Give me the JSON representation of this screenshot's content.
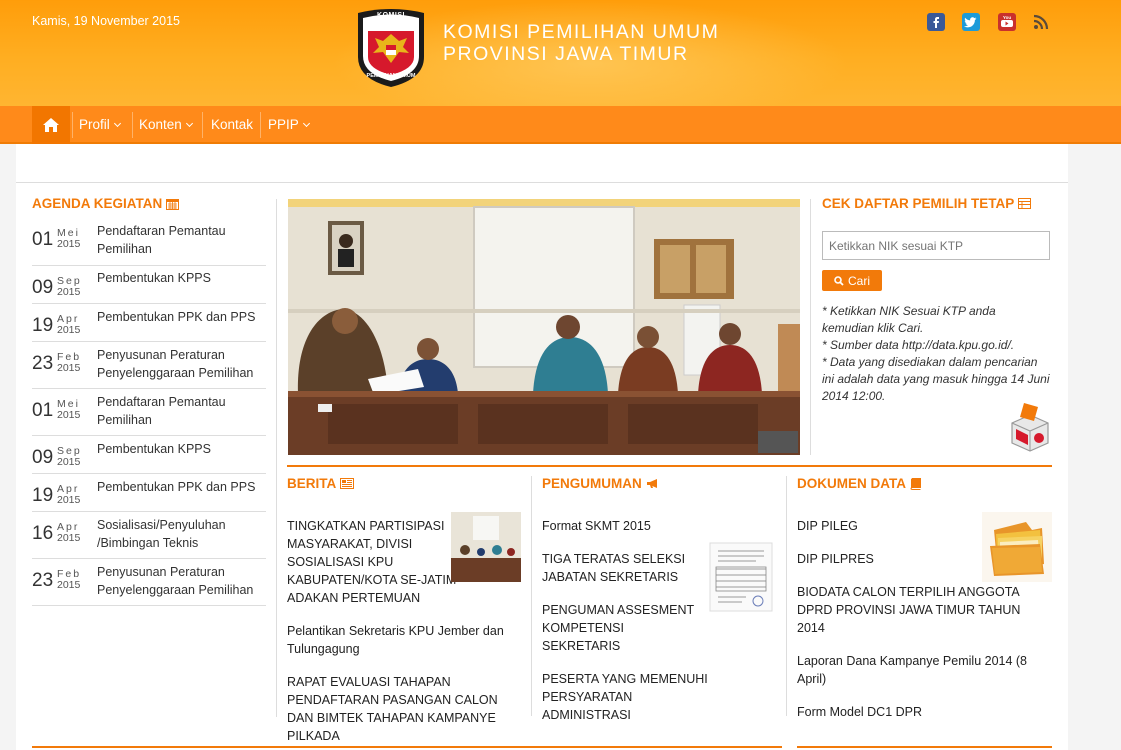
{
  "header": {
    "date": "Kamis, 19 November 2015",
    "title_line1": "KOMISI PEMILIHAN UMUM",
    "title_line2": "PROVINSI JAWA TIMUR",
    "logo_text_top": "KOMISI",
    "logo_text_bottom": "PEMILIHAN UMUM",
    "social": [
      "facebook-icon",
      "twitter-icon",
      "youtube-icon",
      "rss-icon"
    ]
  },
  "nav": {
    "items": [
      {
        "label": "Profil",
        "dropdown": true
      },
      {
        "label": "Konten",
        "dropdown": true
      },
      {
        "label": "Kontak",
        "dropdown": false
      },
      {
        "label": "PPIP",
        "dropdown": true
      }
    ]
  },
  "agenda": {
    "title": "AGENDA KEGIATAN",
    "items": [
      {
        "day": "01",
        "month": "Mei",
        "year": "2015",
        "text": "Pendaftaran Pemantau Pemilihan"
      },
      {
        "day": "09",
        "month": "Sep",
        "year": "2015",
        "text": "Pembentukan KPPS"
      },
      {
        "day": "19",
        "month": "Apr",
        "year": "2015",
        "text": "Pembentukan PPK dan PPS"
      },
      {
        "day": "23",
        "month": "Feb",
        "year": "2015",
        "text": "Penyusunan Peraturan Penyelenggaraan Pemilihan"
      },
      {
        "day": "01",
        "month": "Mei",
        "year": "2015",
        "text": "Pendaftaran Pemantau Pemilihan"
      },
      {
        "day": "09",
        "month": "Sep",
        "year": "2015",
        "text": "Pembentukan KPPS"
      },
      {
        "day": "19",
        "month": "Apr",
        "year": "2015",
        "text": "Pembentukan PPK dan PPS"
      },
      {
        "day": "16",
        "month": "Apr",
        "year": "2015",
        "text": "Sosialisasi/Penyuluhan /Bimbingan Teknis"
      },
      {
        "day": "23",
        "month": "Feb",
        "year": "2015",
        "text": "Penyusunan Peraturan Penyelenggaraan Pemilihan"
      }
    ]
  },
  "dpt": {
    "title": "CEK DAFTAR PEMILIH TETAP",
    "placeholder": "Ketikkan NIK sesuai KTP",
    "button": "Cari",
    "note1": "* Ketikkan NIK Sesuai KTP anda kemudian klik Cari.",
    "note2": "* Sumber data http://data.kpu.go.id/.",
    "note3": "* Data yang disediakan dalam pencarian ini adalah data yang masuk hingga 14 Juni 2014 12:00."
  },
  "berita": {
    "title": "BERITA",
    "items": [
      "TINGKATKAN PARTISIPASI MASYARAKAT, DIVISI SOSIALISASI KPU KABUPATEN/KOTA SE-JATIM ADAKAN PERTEMUAN",
      "Pelantikan Sekretaris KPU Jember dan Tulungagung",
      "RAPAT EVALUASI TAHAPAN PENDAFTARAN PASANGAN CALON DAN BIMTEK TAHAPAN KAMPANYE PILKADA"
    ]
  },
  "pengumuman": {
    "title": "PENGUMUMAN",
    "items": [
      "Format SKMT 2015",
      "TIGA TERATAS SELEKSI JABATAN SEKRETARIS",
      "PENGUMAN ASSESMENT KOMPETENSI SEKRETARIS",
      "PESERTA YANG MEMENUHI PERSYARATAN ADMINISTRASI"
    ]
  },
  "dokumen": {
    "title": "DOKUMEN DATA",
    "items": [
      "DIP PILEG",
      "DIP PILPRES",
      "BIODATA CALON TERPILIH ANGGOTA DPRD PROVINSI JAWA TIMUR TAHUN 2014",
      "Laporan Dana Kampanye Pemilu 2014 (8 April)",
      "Form Model DC1 DPR"
    ]
  },
  "colors": {
    "accent": "#f27a0a",
    "header": "#ffa51c",
    "nav": "#ff8a1a"
  }
}
